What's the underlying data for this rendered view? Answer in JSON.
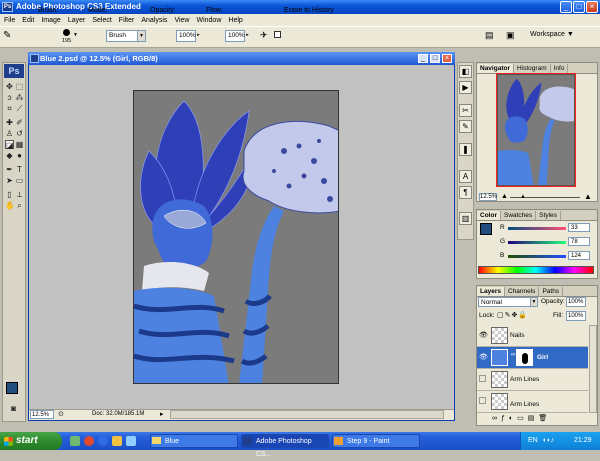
{
  "window": {
    "title": "Adobe Photoshop CS3 Extended"
  },
  "menu": [
    "File",
    "Edit",
    "Image",
    "Layer",
    "Select",
    "Filter",
    "Analysis",
    "View",
    "Window",
    "Help"
  ],
  "options": {
    "brush_label": "Brush:",
    "brush_size": "195",
    "mode_label": "Mode:",
    "mode_value": "Brush",
    "opacity_label": "Opacity:",
    "opacity_value": "100%",
    "flow_label": "Flow:",
    "flow_value": "100%",
    "erase_history_label": "Erase to History",
    "workspace_label": "Workspace"
  },
  "document": {
    "title": "Blue 2.psd @ 12.5% (Girl, RGB/8)",
    "zoom": "12.5%",
    "doc_size": "Doc: 32.0M/185.1M"
  },
  "navigator": {
    "tabs": [
      "Navigator",
      "Histogram",
      "Info"
    ],
    "zoom": "12.5%"
  },
  "color": {
    "tabs": [
      "Color",
      "Swatches",
      "Styles"
    ],
    "r_label": "R",
    "r_value": "33",
    "g_label": "G",
    "g_value": "78",
    "b_label": "B",
    "b_value": "124",
    "foreground": "#214e7c"
  },
  "layers": {
    "tabs": [
      "Layers",
      "Channels",
      "Paths"
    ],
    "blend_mode": "Normal",
    "opacity_label": "Opacity:",
    "opacity_value": "100%",
    "lock_label": "Lock:",
    "fill_label": "Fill:",
    "fill_value": "100%",
    "rows": [
      {
        "name": "Nails"
      },
      {
        "name": "Girl"
      },
      {
        "name": "Arm Lines"
      },
      {
        "name": "Arm Lines"
      }
    ]
  },
  "taskbar": {
    "start": "start",
    "items": [
      "Blue",
      "Adobe Photoshop CS...",
      "Step 9 - Paint"
    ],
    "lang": "EN",
    "clock": "21:29"
  }
}
